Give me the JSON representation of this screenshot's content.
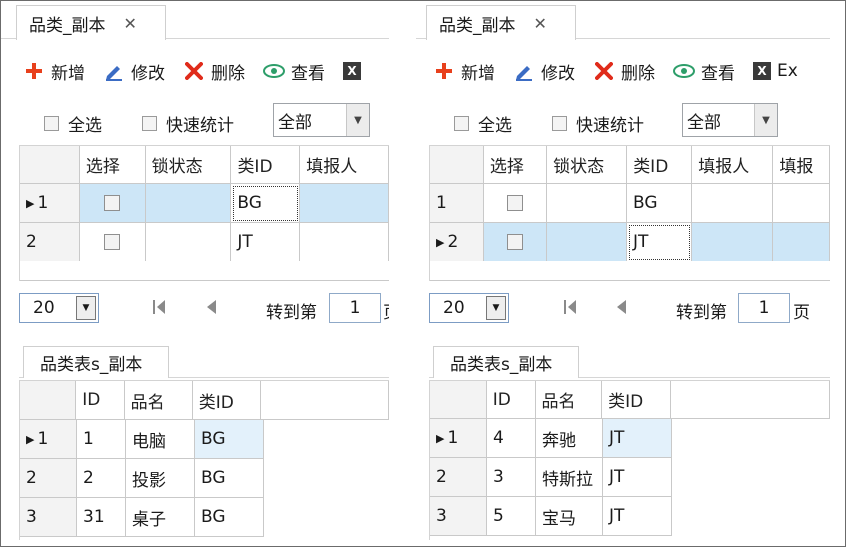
{
  "left": {
    "tab": {
      "title": "品类_副本",
      "close": "✕"
    },
    "toolbar": {
      "add": "新增",
      "edit": "修改",
      "delete": "删除",
      "view": "查看",
      "export_icon": "X"
    },
    "filters": {
      "select_all": "全选",
      "quick_stats": "快速统计",
      "dropdown_value": "全部"
    },
    "grid": {
      "headers": [
        "选择",
        "锁状态",
        "类ID",
        "填报人"
      ],
      "rows": [
        {
          "num": "1",
          "type_id": "BG",
          "selected": true
        },
        {
          "num": "2",
          "type_id": "JT",
          "selected": false
        }
      ]
    },
    "pager": {
      "page_size": "20",
      "goto_label": "转到第",
      "page": "1",
      "unit": "页"
    },
    "sub": {
      "tab": "品类表s_副本",
      "headers": [
        "ID",
        "品名",
        "类ID"
      ],
      "rows": [
        {
          "num": "1",
          "id": "1",
          "name": "电脑",
          "type_id": "BG"
        },
        {
          "num": "2",
          "id": "2",
          "name": "投影",
          "type_id": "BG"
        },
        {
          "num": "3",
          "id": "31",
          "name": "桌子",
          "type_id": "BG"
        }
      ]
    }
  },
  "right": {
    "tab": {
      "title": "品类_副本",
      "close": "✕"
    },
    "toolbar": {
      "add": "新增",
      "edit": "修改",
      "delete": "删除",
      "view": "查看",
      "export": "Ex",
      "export_icon": "X"
    },
    "filters": {
      "select_all": "全选",
      "quick_stats": "快速统计",
      "dropdown_value": "全部"
    },
    "grid": {
      "headers": [
        "选择",
        "锁状态",
        "类ID",
        "填报人",
        "填报"
      ],
      "rows": [
        {
          "num": "1",
          "type_id": "BG",
          "selected": false
        },
        {
          "num": "2",
          "type_id": "JT",
          "selected": true
        }
      ]
    },
    "pager": {
      "page_size": "20",
      "goto_label": "转到第",
      "page": "1",
      "unit": "页"
    },
    "sub": {
      "tab": "品类表s_副本",
      "headers": [
        "ID",
        "品名",
        "类ID"
      ],
      "rows": [
        {
          "num": "1",
          "id": "4",
          "name": "奔驰",
          "type_id": "JT"
        },
        {
          "num": "2",
          "id": "3",
          "name": "特斯拉",
          "type_id": "JT"
        },
        {
          "num": "3",
          "id": "5",
          "name": "宝马",
          "type_id": "JT"
        }
      ]
    }
  },
  "icons": {
    "add": "plus-icon",
    "edit": "pencil-icon",
    "delete": "x-icon",
    "view": "eye-icon",
    "export": "excel-icon",
    "first": "first-page-icon",
    "prev": "prev-page-icon",
    "row_pointer": "row-pointer-icon"
  },
  "colors": {
    "selection": "#cde6f7",
    "add_red": "#e8401c",
    "edit_blue": "#3b6cc4",
    "view_green": "#2e9e6a"
  }
}
